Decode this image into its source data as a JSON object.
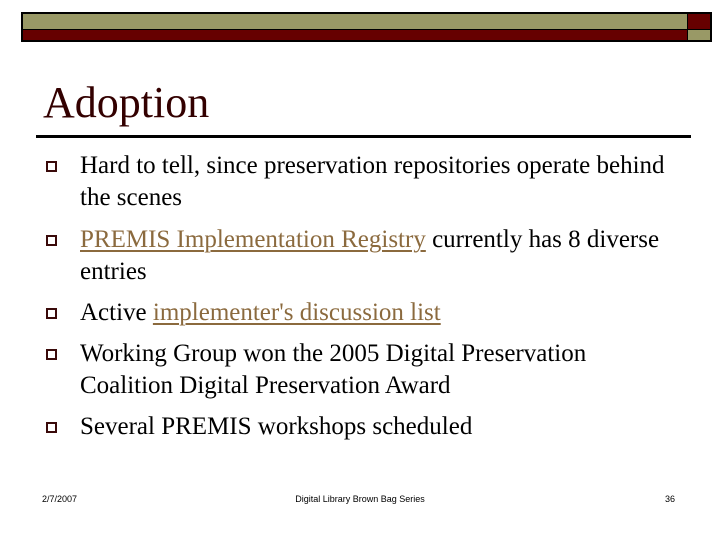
{
  "slide": {
    "title": "Adoption",
    "colors": {
      "title": "#330000",
      "bullet": "#3a0a0a",
      "link": "#8b6a3e",
      "header_olive": "#999966",
      "header_red": "#660000"
    },
    "bullets": [
      {
        "parts": [
          {
            "text": "Hard to tell, since preservation repositories operate behind the scenes",
            "link": false
          }
        ]
      },
      {
        "parts": [
          {
            "text": "PREMIS Implementation Registry",
            "link": true
          },
          {
            "text": " currently has 8 diverse entries",
            "link": false
          }
        ]
      },
      {
        "parts": [
          {
            "text": "Active ",
            "link": false
          },
          {
            "text": "implementer's discussion list",
            "link": true
          }
        ]
      },
      {
        "parts": [
          {
            "text": "Working Group won the 2005 Digital Preservation Coalition Digital Preservation Award",
            "link": false
          }
        ]
      },
      {
        "parts": [
          {
            "text": "Several PREMIS workshops scheduled",
            "link": false
          }
        ]
      }
    ]
  },
  "footer": {
    "date": "2/7/2007",
    "center": "Digital Library Brown Bag Series",
    "page_number": "36"
  }
}
